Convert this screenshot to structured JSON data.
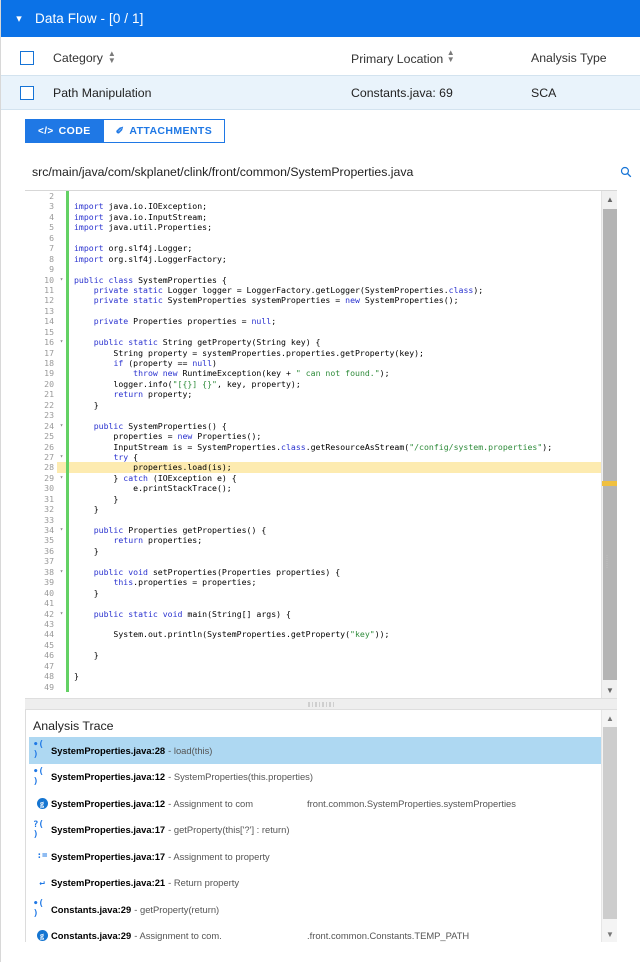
{
  "window": {
    "title": "Data Flow - [0 / 1]",
    "collapse_icon": "chevron-down-icon",
    "accent_color": "#0b72e7"
  },
  "results_table": {
    "columns": [
      {
        "label": "Category",
        "sortable": true
      },
      {
        "label": "Primary Location",
        "sortable": true
      },
      {
        "label": "Analysis Type",
        "sortable": false
      }
    ],
    "rows": [
      {
        "category": "Path Manipulation",
        "primary_location": "Constants.java: 69",
        "analysis_type": "SCA",
        "selected": false
      }
    ]
  },
  "tabs": [
    {
      "label": "CODE",
      "icon": "code-brackets-icon",
      "icon_glyph": "</>",
      "active": true
    },
    {
      "label": "ATTACHMENTS",
      "icon": "paperclip-icon",
      "icon_glyph": "✐",
      "active": false
    }
  ],
  "file": {
    "path": "src/main/java/com/skplanet/clink/front/common/SystemProperties.java",
    "search_icon": "search-icon"
  },
  "code_viewer": {
    "first_line": 2,
    "highlighted_line": 28,
    "fold_lines": [
      10,
      16,
      24,
      27,
      29,
      34,
      38,
      42
    ],
    "lines": [
      {
        "n": 2,
        "text": ""
      },
      {
        "n": 3,
        "text": "import java.io.IOException;"
      },
      {
        "n": 4,
        "text": "import java.io.InputStream;"
      },
      {
        "n": 5,
        "text": "import java.util.Properties;"
      },
      {
        "n": 6,
        "text": ""
      },
      {
        "n": 7,
        "text": "import org.slf4j.Logger;"
      },
      {
        "n": 8,
        "text": "import org.slf4j.LoggerFactory;"
      },
      {
        "n": 9,
        "text": ""
      },
      {
        "n": 10,
        "text": "public class SystemProperties {"
      },
      {
        "n": 11,
        "text": "    private static Logger logger = LoggerFactory.getLogger(SystemProperties.class);"
      },
      {
        "n": 12,
        "text": "    private static SystemProperties systemProperties = new SystemProperties();"
      },
      {
        "n": 13,
        "text": ""
      },
      {
        "n": 14,
        "text": "    private Properties properties = null;"
      },
      {
        "n": 15,
        "text": ""
      },
      {
        "n": 16,
        "text": "    public static String getProperty(String key) {"
      },
      {
        "n": 17,
        "text": "        String property = systemProperties.properties.getProperty(key);"
      },
      {
        "n": 18,
        "text": "        if (property == null)"
      },
      {
        "n": 19,
        "text": "            throw new RuntimeException(key + \" can not found.\");"
      },
      {
        "n": 20,
        "text": "        logger.info(\"[{}] {}\", key, property);"
      },
      {
        "n": 21,
        "text": "        return property;"
      },
      {
        "n": 22,
        "text": "    }"
      },
      {
        "n": 23,
        "text": ""
      },
      {
        "n": 24,
        "text": "    public SystemProperties() {"
      },
      {
        "n": 25,
        "text": "        properties = new Properties();"
      },
      {
        "n": 26,
        "text": "        InputStream is = SystemProperties.class.getResourceAsStream(\"/config/system.properties\");"
      },
      {
        "n": 27,
        "text": "        try {"
      },
      {
        "n": 28,
        "text": "            properties.load(is);"
      },
      {
        "n": 29,
        "text": "        } catch (IOException e) {"
      },
      {
        "n": 30,
        "text": "            e.printStackTrace();"
      },
      {
        "n": 31,
        "text": "        }"
      },
      {
        "n": 32,
        "text": "    }"
      },
      {
        "n": 33,
        "text": ""
      },
      {
        "n": 34,
        "text": "    public Properties getProperties() {"
      },
      {
        "n": 35,
        "text": "        return properties;"
      },
      {
        "n": 36,
        "text": "    }"
      },
      {
        "n": 37,
        "text": ""
      },
      {
        "n": 38,
        "text": "    public void setProperties(Properties properties) {"
      },
      {
        "n": 39,
        "text": "        this.properties = properties;"
      },
      {
        "n": 40,
        "text": "    }"
      },
      {
        "n": 41,
        "text": ""
      },
      {
        "n": 42,
        "text": "    public static void main(String[] args) {"
      },
      {
        "n": 43,
        "text": ""
      },
      {
        "n": 44,
        "text": "        System.out.println(SystemProperties.getProperty(\"key\"));"
      },
      {
        "n": 45,
        "text": ""
      },
      {
        "n": 46,
        "text": "    }"
      },
      {
        "n": 47,
        "text": ""
      },
      {
        "n": 48,
        "text": "}"
      },
      {
        "n": 49,
        "text": ""
      }
    ]
  },
  "analysis_trace": {
    "title": "Analysis Trace",
    "items": [
      {
        "icon": "call-icon",
        "icon_glyph": "•( )",
        "location": "SystemProperties.java:28",
        "description": "- load(this)",
        "extra": "",
        "selected": true
      },
      {
        "icon": "call-icon",
        "icon_glyph": "•( )",
        "location": "SystemProperties.java:12",
        "description": "- SystemProperties(this.properties)",
        "extra": "",
        "selected": false
      },
      {
        "icon": "assignment-icon",
        "icon_glyph": "g",
        "location": "SystemProperties.java:12",
        "description": "- Assignment to com",
        "extra": "front.common.SystemProperties.systemProperties",
        "selected": false
      },
      {
        "icon": "query-call-icon",
        "icon_glyph": "?( )",
        "location": "SystemProperties.java:17",
        "description": "- getProperty(this['?'] : return)",
        "extra": "",
        "selected": false
      },
      {
        "icon": "assign-op-icon",
        "icon_glyph": ":=",
        "location": "SystemProperties.java:17",
        "description": "- Assignment to property",
        "extra": "",
        "selected": false
      },
      {
        "icon": "return-icon",
        "icon_glyph": "↵",
        "location": "SystemProperties.java:21",
        "description": "- Return property",
        "extra": "",
        "selected": false
      },
      {
        "icon": "call-icon",
        "icon_glyph": "•( )",
        "location": "Constants.java:29",
        "description": "- getProperty(return)",
        "extra": "",
        "selected": false
      },
      {
        "icon": "assignment-icon",
        "icon_glyph": "g",
        "location": "Constants.java:29",
        "description": "- Assignment to com.",
        "extra": ".front.common.Constants.TEMP_PATH",
        "selected": false
      }
    ]
  },
  "scrollbars": {
    "code_up_arrow": "chevron-up-icon",
    "code_down_arrow": "chevron-down-icon",
    "trace_up_arrow": "chevron-up-icon",
    "trace_down_arrow": "chevron-down-icon"
  },
  "splitter": {
    "handle_icon": "grip-dots-icon"
  }
}
